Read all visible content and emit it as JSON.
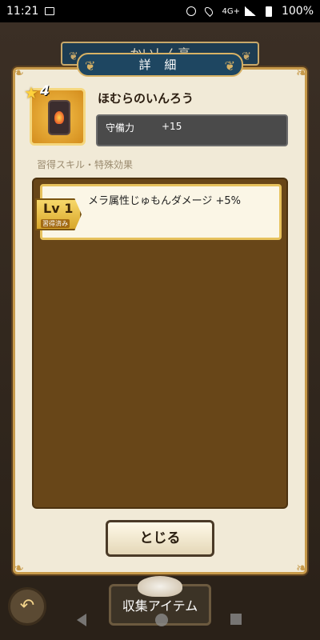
{
  "status_bar": {
    "time": "11:21",
    "network": "4G+",
    "battery": "100%"
  },
  "screen": {
    "banner_title": "かいしん亭"
  },
  "dialog": {
    "title": "詳 細",
    "item": {
      "name": "ほむらのいんろう",
      "rarity_stars": "4",
      "stat_label": "守備力",
      "stat_value": "+15"
    },
    "section_label": "習得スキル・特殊効果",
    "skills": [
      {
        "level": "Lv 1",
        "status": "習得済み",
        "text": "メラ属性じゅもんダメージ +5%"
      }
    ],
    "close_label": "とじる"
  },
  "bottom": {
    "collect_label": "収集アイテム"
  },
  "colors": {
    "accent_gold": "#c79a4a",
    "title_blue": "#1e4661",
    "panel_brown": "#684618"
  }
}
